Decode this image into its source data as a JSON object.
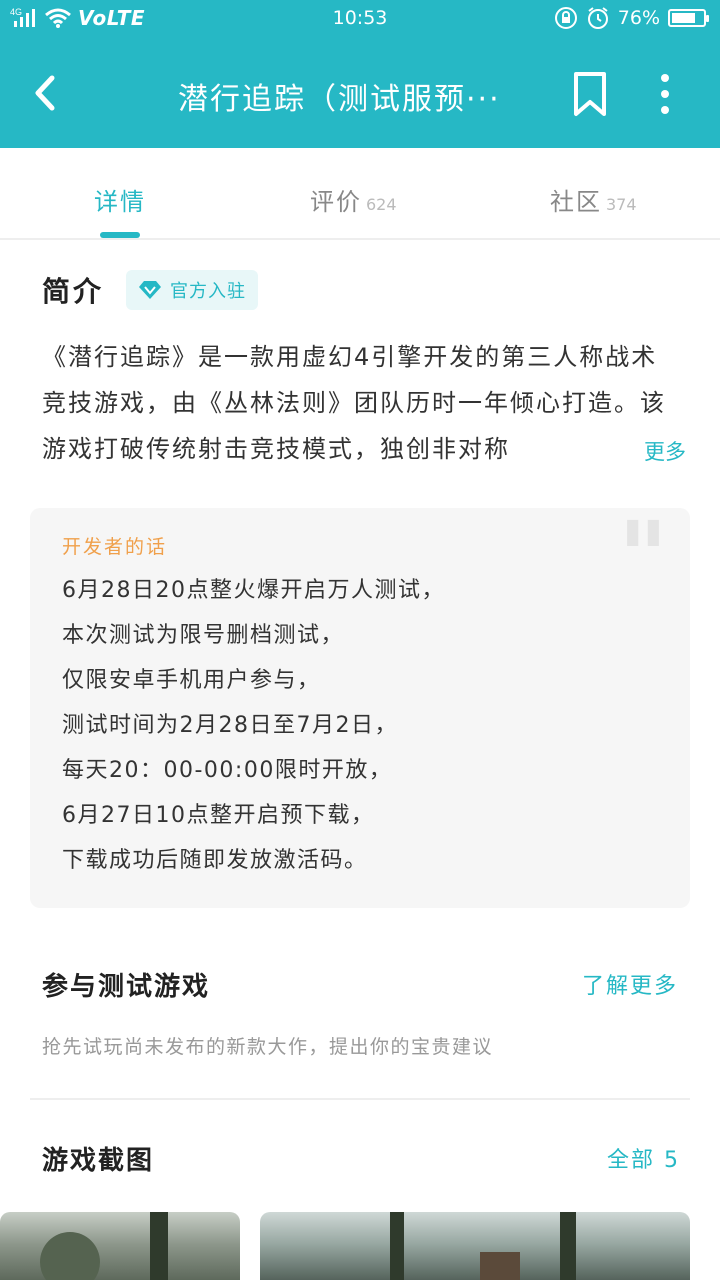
{
  "status_bar": {
    "network": "4G",
    "volte": "VoLTE",
    "time": "10:53",
    "battery": "76%",
    "battery_level": 0.76
  },
  "header": {
    "title": "潜行追踪（测试服预···",
    "back_icon": "back-arrow-icon",
    "bookmark_icon": "bookmark-icon",
    "more_icon": "more-vertical-icon",
    "color": "#26b8c5"
  },
  "tabs": [
    {
      "label": "详情",
      "count": ""
    },
    {
      "label": "评价",
      "count": "624"
    },
    {
      "label": "社区",
      "count": "374"
    }
  ],
  "intro": {
    "title": "简介",
    "badge": "官方入驻",
    "badge_icon": "diamond-icon",
    "text": "《潜行追踪》是一款用虚幻4引擎开发的第三人称战术竞技游戏，由《丛林法则》团队历时一年倾心打造。该游戏打破传统射击竞技模式，独创非对称",
    "more": "更多"
  },
  "developer_note": {
    "label": "开发者的话",
    "lines": [
      "6月28日20点整火爆开启万人测试，",
      "本次测试为限号删档测试，",
      "仅限安卓手机用户参与，",
      "测试时间为2月28日至7月2日，",
      "每天20：00-00:00限时开放，",
      "6月27日10点整开启预下载，",
      "下载成功后随即发放激活码。"
    ]
  },
  "test_games": {
    "title": "参与测试游戏",
    "more": "了解更多",
    "desc": "抢先试玩尚未发布的新款大作，提出你的宝贵建议"
  },
  "screenshots": {
    "title": "游戏截图",
    "all": "全部 5"
  }
}
